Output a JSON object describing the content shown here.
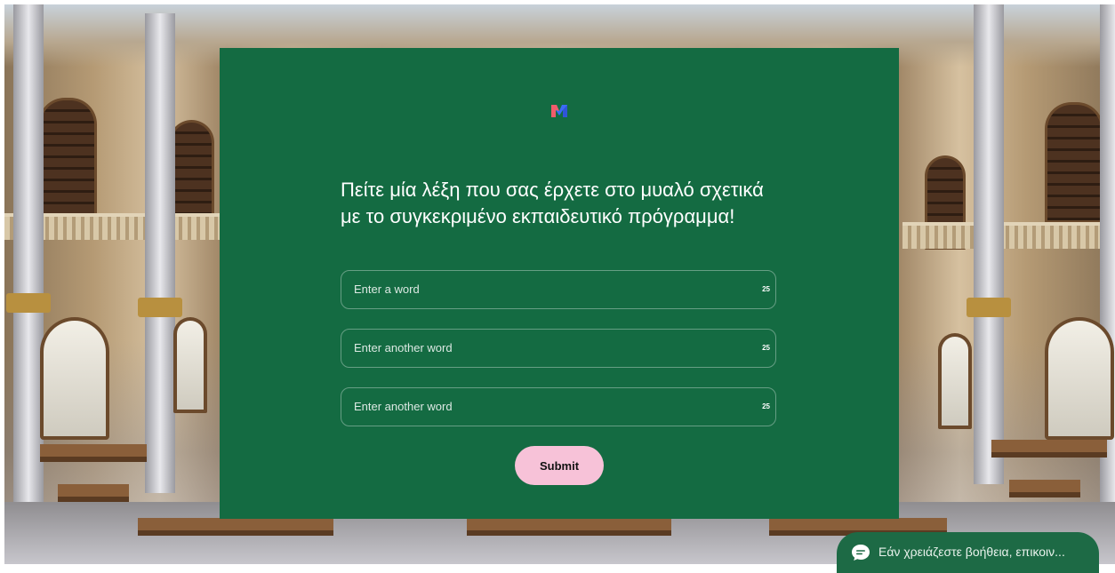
{
  "question": {
    "text": "Πείτε μία λέξη που σας έρχετε στο μυαλό σχετικά με το συγκεκριμένο εκπαιδευτικό πρόγραμμα!"
  },
  "fields": [
    {
      "placeholder": "Enter a word",
      "char_limit": "25"
    },
    {
      "placeholder": "Enter another word",
      "char_limit": "25"
    },
    {
      "placeholder": "Enter another word",
      "char_limit": "25"
    }
  ],
  "submit": {
    "label": "Submit"
  },
  "chat_widget": {
    "icon": "chat-bubble-icon",
    "text": "Εάν χρειάζεστε βοήθεια, επικοιν..."
  },
  "logo": {
    "icon": "mentimeter-logo-icon"
  },
  "colors": {
    "card_background": "#146b42",
    "submit_background": "#f7c2d8",
    "chat_background": "#1d6a45"
  }
}
